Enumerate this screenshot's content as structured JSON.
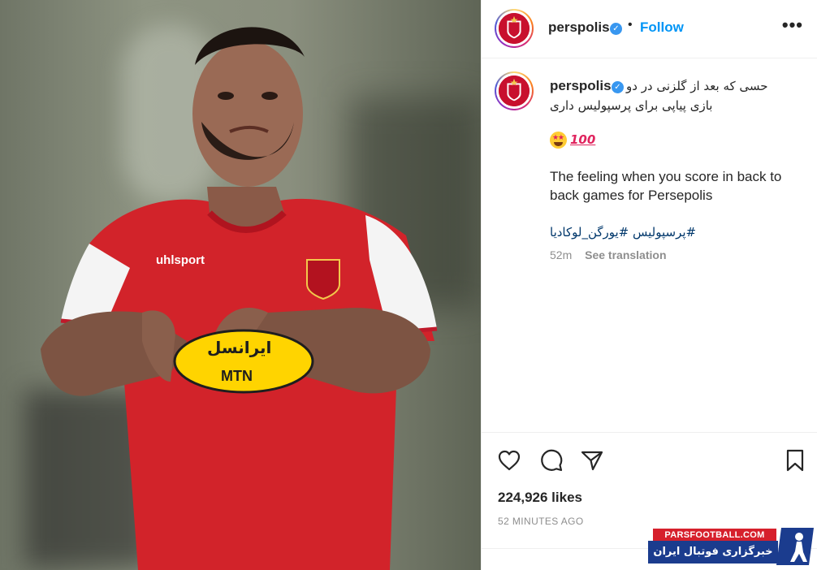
{
  "post": {
    "username": "perspolis",
    "follow_label": "Follow",
    "more_label": "•••",
    "dot": "•"
  },
  "caption": {
    "username": "perspolis",
    "persian_line1": "حسی که بعد از گلزنی در دو",
    "persian_line2": "بازی پیاپی برای پرسپولیس داری",
    "emojis": [
      "star-struck-emoji",
      "hundred-points-emoji"
    ],
    "hundred_text": "100",
    "english_text": "The feeling when you score in back to back games for Persepolis",
    "hashtags": "#پرسپولیس #یورگن_لوکادیا",
    "time": "52m",
    "see_translation": "See translation"
  },
  "actions": {
    "icons": [
      "heart-icon",
      "comment-icon",
      "share-icon",
      "bookmark-icon"
    ],
    "likes": "224,926 likes",
    "time_ago": "52 MINUTES AGO"
  },
  "photo": {
    "jersey_brand": "uhlsport",
    "sponsor_text": "MTN",
    "sponsor_persian": "ایرانسل"
  },
  "watermark": {
    "site": "PARSFOOTBALL.COM",
    "persian": "خبرگزاری فوتبال ایران"
  },
  "colors": {
    "follow_blue": "#0095f6",
    "verified_blue": "#3897f0",
    "jersey_red": "#d2232a",
    "hashtag_blue": "#00376b"
  }
}
